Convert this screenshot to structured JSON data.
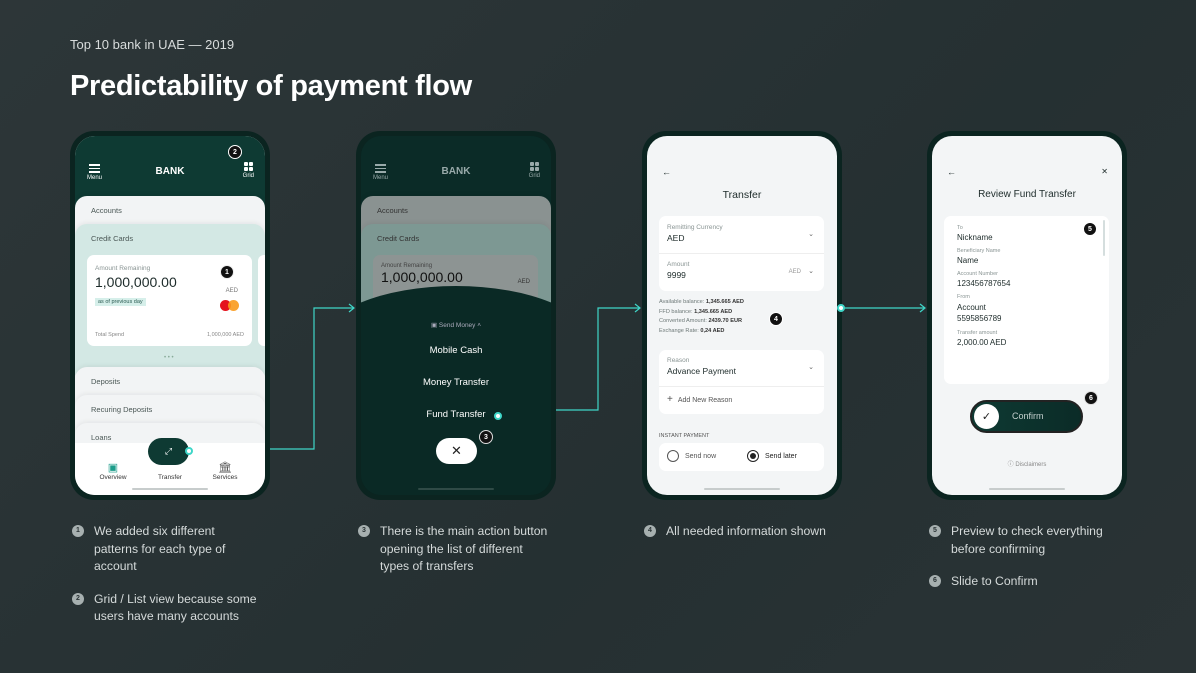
{
  "slide": {
    "supertitle": "Top 10 bank in UAE — 2019",
    "title": "Predictability of payment flow"
  },
  "colors": {
    "accent": "#3fd6c8",
    "header": "#0e3a33",
    "background": "#2b3436"
  },
  "phone1": {
    "menu": "Menu",
    "brand": "BANK",
    "grid": "Grid",
    "badge_grid": "2",
    "accounts": "Accounts",
    "credit_cards": "Credit Cards",
    "card": {
      "amount_label": "Amount Remaining",
      "amount": "1,000,000.00",
      "currency": "AED",
      "as_of": "as of previous day",
      "badge": "1",
      "total_spend_label": "Total Spend",
      "total_spend": "1,000,000 AED"
    },
    "deposits": "Deposits",
    "recurring": "Recuring Deposits",
    "loans": "Loans",
    "tabs": [
      "Overview",
      "Transfer",
      "Services"
    ]
  },
  "phone2": {
    "menu": "Menu",
    "brand": "BANK",
    "grid": "Grid",
    "accounts": "Accounts",
    "credit_cards": "Credit Cards",
    "amount_label": "Amount Remaining",
    "amount": "1,000,000.00",
    "currency": "AED",
    "send_money": "Send Money",
    "options": [
      "Mobile Cash",
      "Money Transfer",
      "Fund Transfer"
    ],
    "badge": "3"
  },
  "phone3": {
    "title": "Transfer",
    "remitting_label": "Remitting Currency",
    "remitting": "AED",
    "amount_label": "Amount",
    "amount": "9999",
    "amount_currency": "AED",
    "info": [
      {
        "label": "Available balance:",
        "value": "1,345.665 AED"
      },
      {
        "label": "FFD balance:",
        "value": "1,345.665 AED"
      },
      {
        "label": "Converted Amount:",
        "value": "2439.70 EUR"
      },
      {
        "label": "Exchange Rate:",
        "value": "0,24 AED"
      }
    ],
    "badge": "4",
    "reason_label": "Reason",
    "reason": "Advance Payment",
    "add_reason": "Add New Reason",
    "instant_label": "INSTANT PAYMENT",
    "send_now": "Send now",
    "send_later": "Send later",
    "selected": "Send later"
  },
  "phone4": {
    "title": "Review Fund Transfer",
    "badge5": "5",
    "badge6": "6",
    "fields": [
      {
        "label": "To",
        "value": "Nickname"
      },
      {
        "label": "Beneficiary Name",
        "value": "Name"
      },
      {
        "label": "Account Number",
        "value": "123456787654"
      },
      {
        "label": "From",
        "value": "Account\n5595856789"
      },
      {
        "label": "Transfer amount",
        "value": "2,000.00 AED"
      }
    ],
    "confirm": "Confirm",
    "disclaimers": "Disclaimers"
  },
  "captions": {
    "c1": [
      {
        "n": "1",
        "text": "We added six different patterns for each type of account"
      },
      {
        "n": "2",
        "text": "Grid / List view because some users have many accounts"
      }
    ],
    "c2": [
      {
        "n": "3",
        "text": "There is the main action button opening the list of different types of transfers"
      }
    ],
    "c3": [
      {
        "n": "4",
        "text": "All needed information shown"
      }
    ],
    "c4": [
      {
        "n": "5",
        "text": "Preview to check everything before confirming"
      },
      {
        "n": "6",
        "text": "Slide to Confirm"
      }
    ]
  }
}
